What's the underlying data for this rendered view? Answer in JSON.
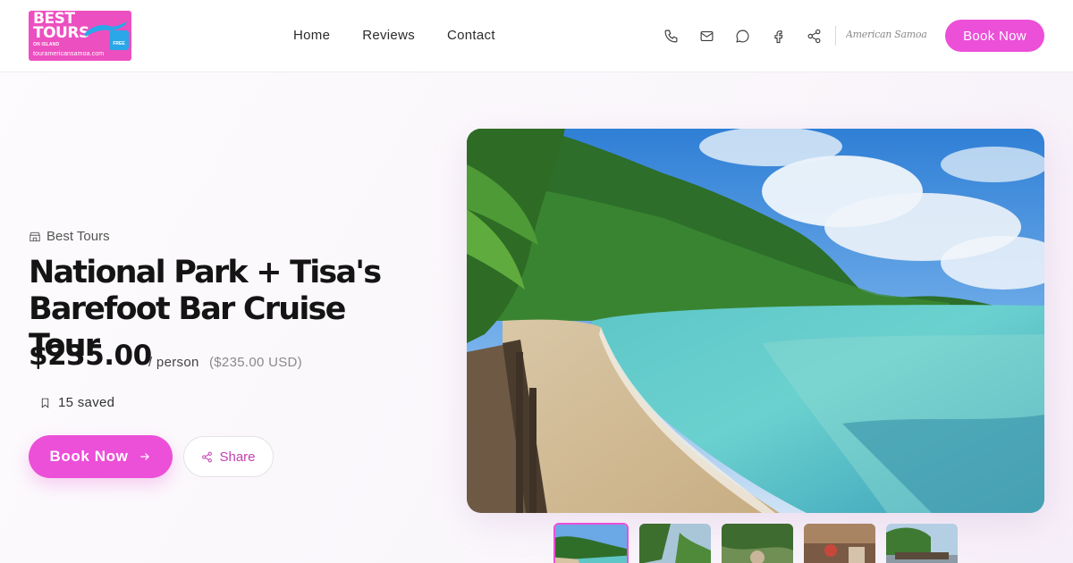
{
  "header": {
    "logo": {
      "line1": "BEST",
      "line2": "TOURS",
      "line3": "ON ISLAND",
      "badge": "FREE",
      "url": "touramericansamoa.com"
    },
    "nav": [
      {
        "label": "Home"
      },
      {
        "label": "Reviews"
      },
      {
        "label": "Contact"
      }
    ],
    "icons": [
      "phone-icon",
      "mail-icon",
      "chat-icon",
      "facebook-icon",
      "share-icon"
    ],
    "partner_logo": "American Samoa",
    "book_label": "Book Now"
  },
  "tour": {
    "provider": "Best Tours",
    "title": "National Park + Tisa's Barefoot Bar Cruise Tour",
    "price": "$235.00",
    "per": "/ person",
    "usd": "($235.00 USD)",
    "saved": "15 saved",
    "book_label": "Book Now",
    "share_label": "Share"
  },
  "gallery": {
    "active_index": 0,
    "thumb_count": 5
  },
  "colors": {
    "accent": "#ec4fd8",
    "accent_text": "#c23fb0",
    "logo_bg": "#ec4fbf"
  }
}
